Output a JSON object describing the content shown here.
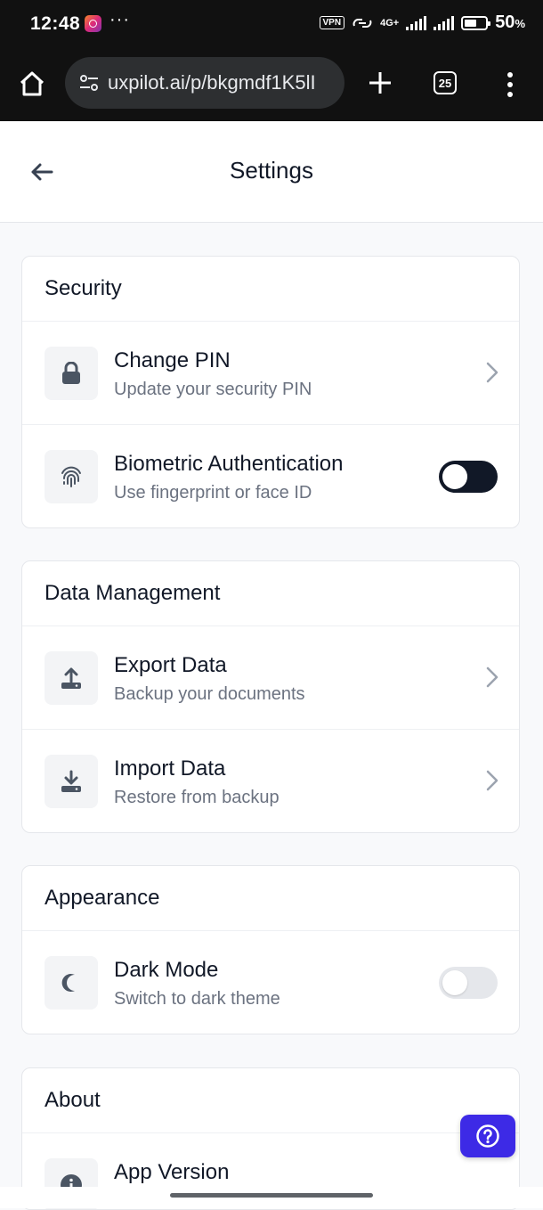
{
  "status_bar": {
    "time": "12:48",
    "vpn": "VPN",
    "network": "4G+",
    "battery_percent": "50",
    "battery_unit": "%",
    "battery_level": 0.5
  },
  "browser": {
    "url": "uxpilot.ai/p/bkgmdf1K5lI",
    "tab_count": "25"
  },
  "header": {
    "title": "Settings"
  },
  "sections": [
    {
      "title": "Security",
      "items": [
        {
          "title": "Change PIN",
          "subtitle": "Update your security PIN",
          "icon": "lock-icon",
          "control": "chevron"
        },
        {
          "title": "Biometric Authentication",
          "subtitle": "Use fingerprint or face ID",
          "icon": "fingerprint-icon",
          "control": "toggle",
          "toggle_on": true
        }
      ]
    },
    {
      "title": "Data Management",
      "items": [
        {
          "title": "Export Data",
          "subtitle": "Backup your documents",
          "icon": "upload-icon",
          "control": "chevron"
        },
        {
          "title": "Import Data",
          "subtitle": "Restore from backup",
          "icon": "download-icon",
          "control": "chevron"
        }
      ]
    },
    {
      "title": "Appearance",
      "items": [
        {
          "title": "Dark Mode",
          "subtitle": "Switch to dark theme",
          "icon": "moon-icon",
          "control": "toggle",
          "toggle_on": false
        }
      ]
    },
    {
      "title": "About",
      "items": [
        {
          "title": "App Version",
          "subtitle": "",
          "icon": "info-icon",
          "control": "none"
        }
      ]
    }
  ],
  "colors": {
    "accent": "#3d2ae6",
    "toggle_on": "#111827",
    "toggle_off": "#e5e7eb",
    "background": "#f8f9fb"
  }
}
